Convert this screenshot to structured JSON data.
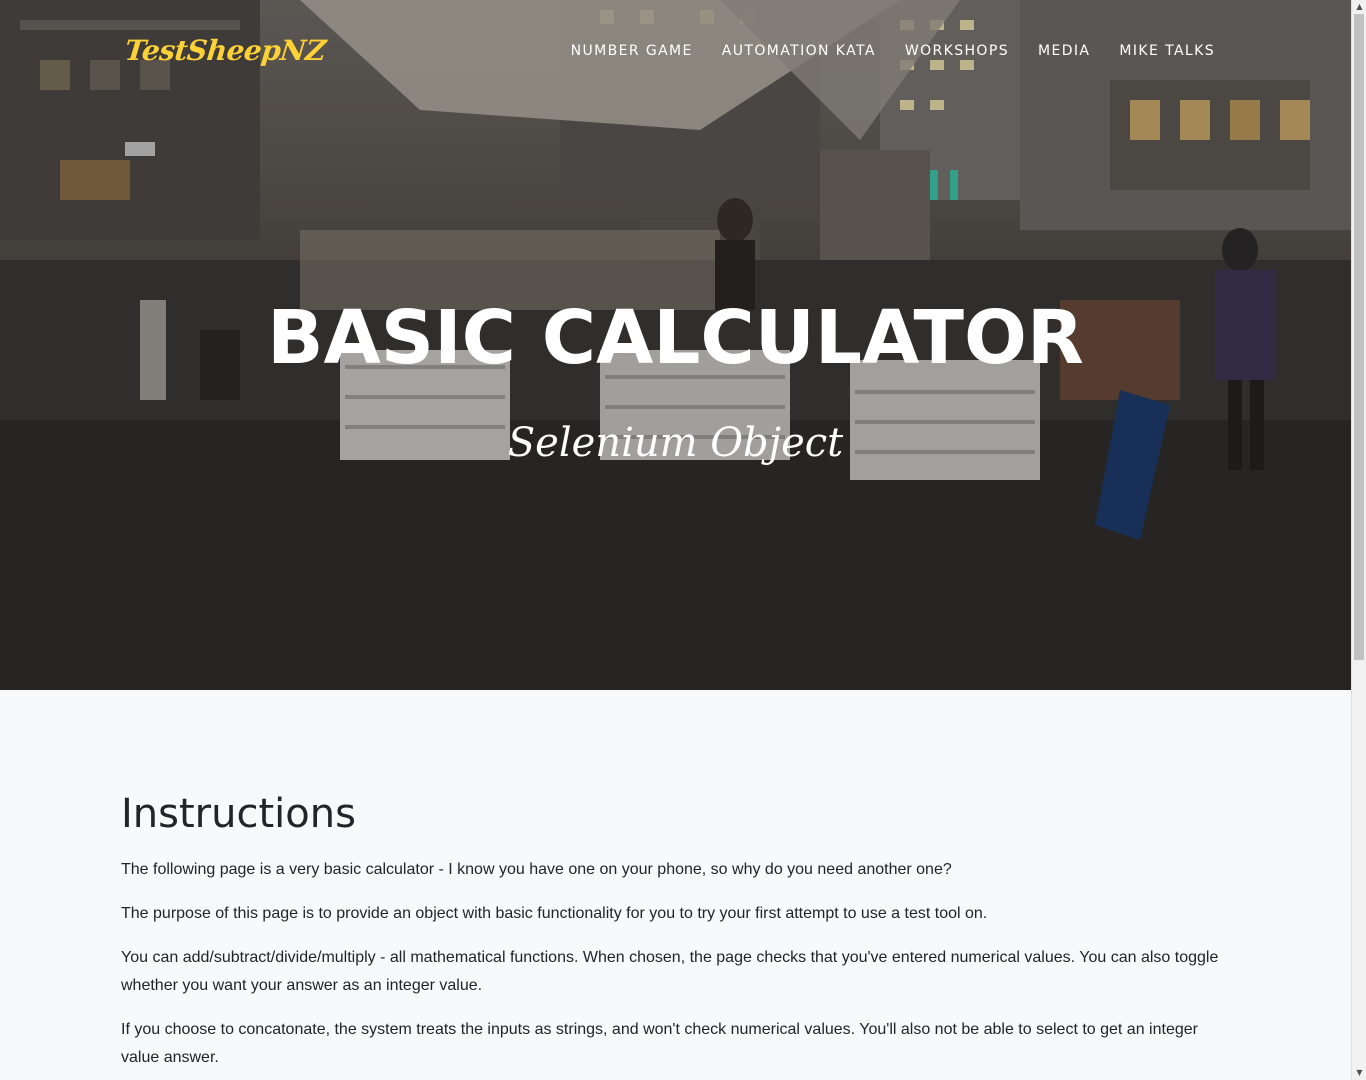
{
  "brand": "TestSheepNZ",
  "nav": {
    "items": [
      {
        "label": "NUMBER GAME"
      },
      {
        "label": "AUTOMATION KATA"
      },
      {
        "label": "WORKSHOPS"
      },
      {
        "label": "MEDIA"
      },
      {
        "label": "MIKE TALKS"
      }
    ]
  },
  "hero": {
    "title": "BASIC CALCULATOR",
    "subtitle": "Selenium Object"
  },
  "instructions": {
    "heading": "Instructions",
    "paragraphs": [
      "The following page is a very basic calculator - I know you have one on your phone, so why do you need another one?",
      "The purpose of this page is to provide an object with basic functionality for you to try your first attempt to use a test tool on.",
      "You can add/subtract/divide/multiply - all mathematical functions. When chosen, the page checks that you've entered numerical values. You can also toggle whether you want your answer as an integer value.",
      "If you choose to concatonate, the system treats the inputs as strings, and won't check numerical values. You'll also not be able to select to get an integer value answer."
    ]
  },
  "colors": {
    "brand": "#fed136",
    "text": "#212529",
    "background": "#f8f9fa"
  }
}
